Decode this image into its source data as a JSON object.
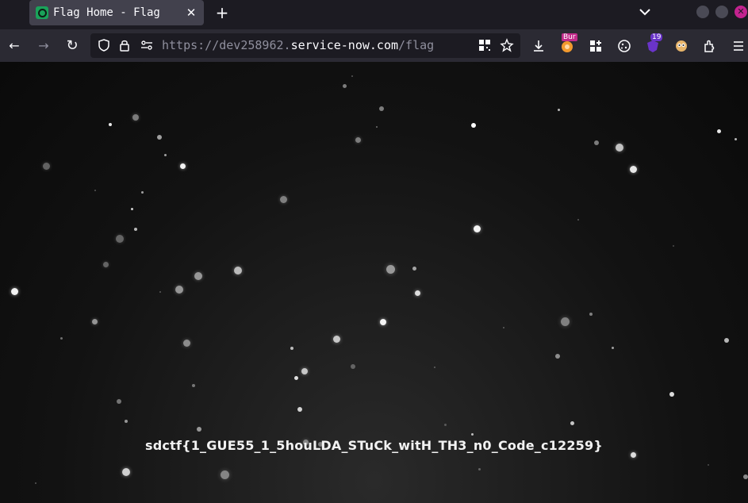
{
  "tab": {
    "title": "Flag Home - Flag",
    "close_glyph": "✕"
  },
  "toolbar": {
    "new_tab_glyph": "+",
    "back_glyph": "←",
    "forward_glyph": "→",
    "reload_glyph": "↻"
  },
  "url": {
    "prefix": "https://dev258962.",
    "domain": "service-now.com",
    "path": "/flag"
  },
  "extensions": {
    "burp_badge": "Bur",
    "ublock_count": "19"
  },
  "page": {
    "flag_text": "sdctf{1_GUE55_1_5houLDA_STuCk_witH_TH3_n0_Code_c12259}"
  },
  "colors": {
    "tab_bg": "#42414d",
    "chrome_bg": "#1c1b22",
    "toolbar_bg": "#2b2a33",
    "close_window": "#c3238f"
  },
  "icons": [
    "shield-icon",
    "lock-icon",
    "permissions-icon",
    "qr-icon",
    "star-icon",
    "download-icon",
    "extensions-icon",
    "menu-icon"
  ]
}
